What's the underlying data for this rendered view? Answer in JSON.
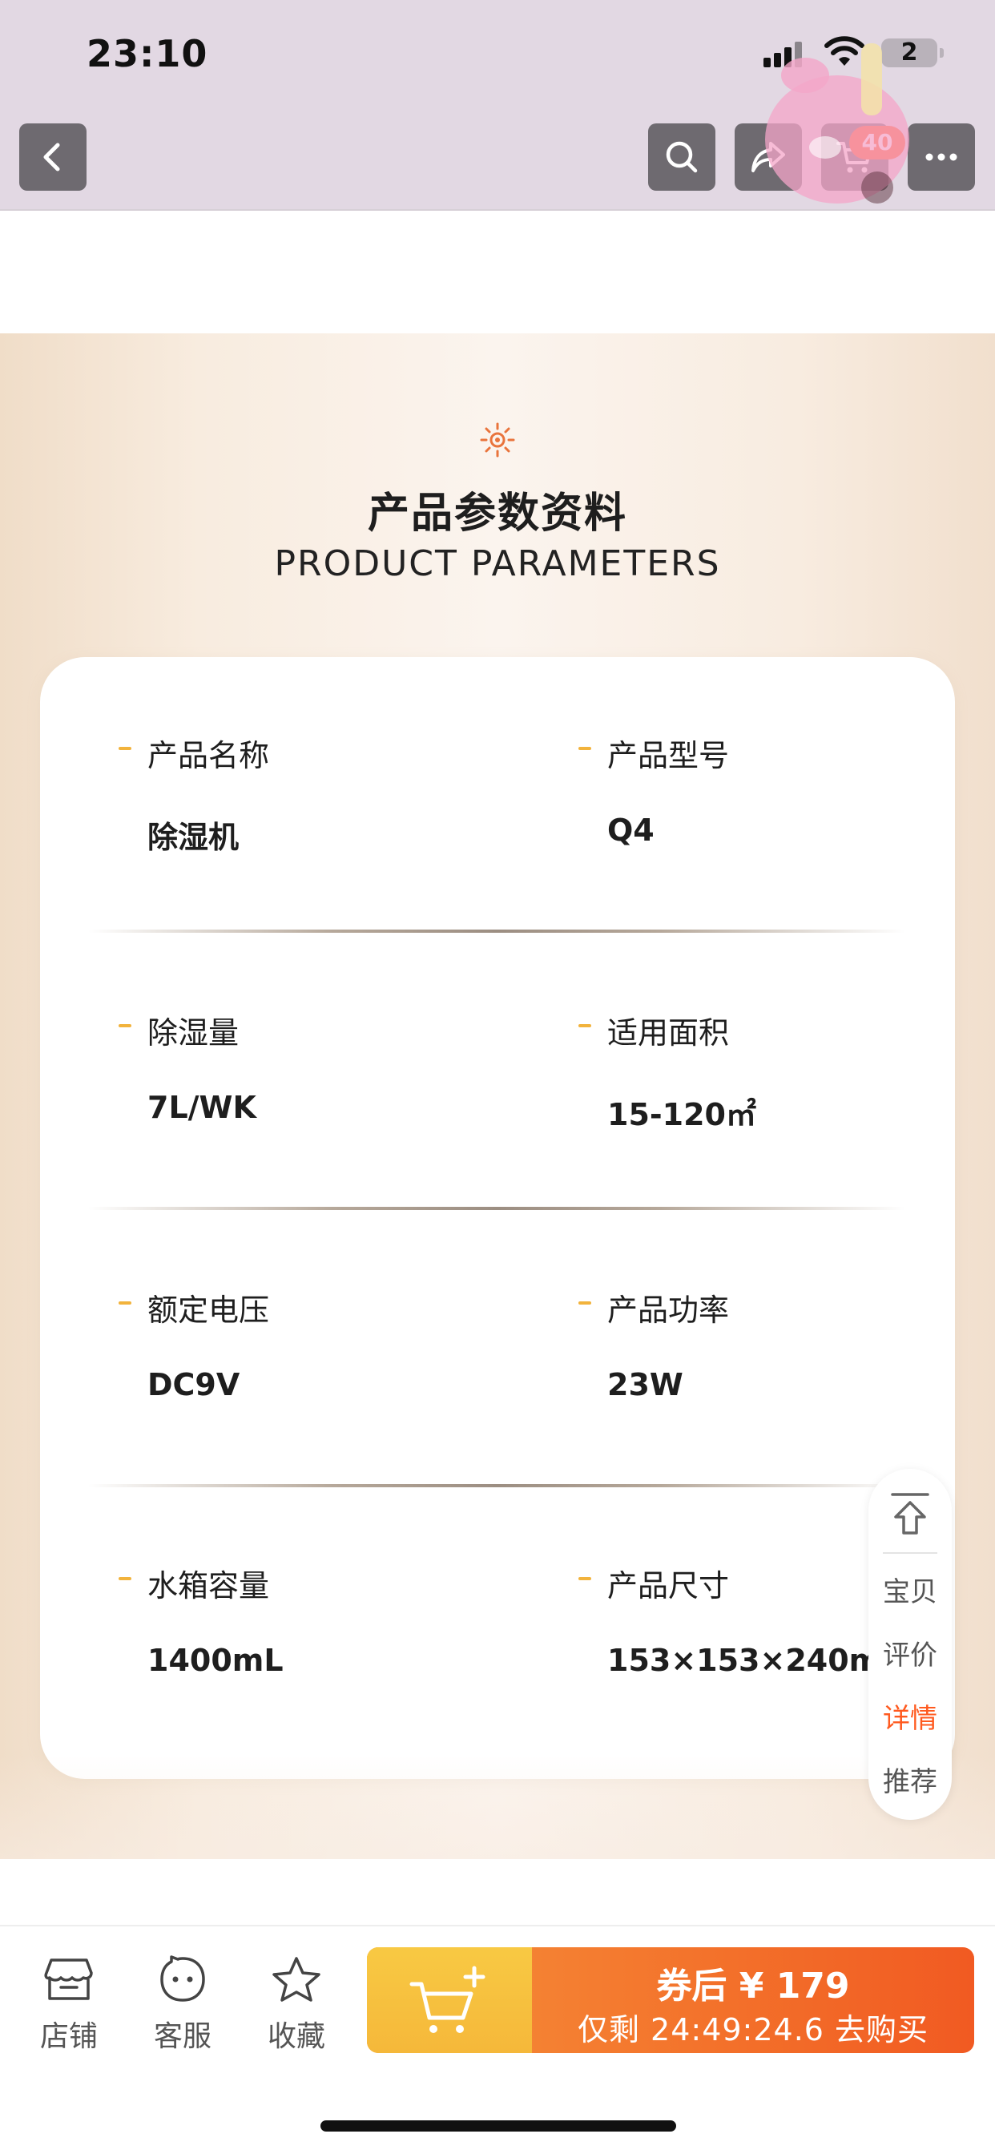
{
  "status_bar": {
    "time": "23:10",
    "battery": "2"
  },
  "header": {
    "cart_badge": "40"
  },
  "params": {
    "title": "产品参数资料",
    "subtitle": "PRODUCT PARAMETERS",
    "rows": [
      [
        {
          "label": "产品名称",
          "value": "除湿机"
        },
        {
          "label": "产品型号",
          "value": "Q4"
        }
      ],
      [
        {
          "label": "除湿量",
          "value": "7L/WK"
        },
        {
          "label": "适用面积",
          "value": "15-120㎡"
        }
      ],
      [
        {
          "label": "额定电压",
          "value": "DC9V"
        },
        {
          "label": "产品功率",
          "value": "23W"
        }
      ],
      [
        {
          "label": "水箱容量",
          "value": "1400mL"
        },
        {
          "label": "产品尺寸",
          "value": "153×153×240mm"
        }
      ]
    ]
  },
  "float_nav": {
    "items": [
      "宝贝",
      "评价",
      "详情",
      "推荐"
    ],
    "active_index": 2
  },
  "bottom_bar": {
    "store": "店铺",
    "service": "客服",
    "favorite": "收藏",
    "buy_price": "券后 ¥ 179",
    "buy_countdown": "仅剩 24:49:24.6 去购买"
  },
  "colors": {
    "accent": "#ff5a1f",
    "buy_gradient_start": "#f5903a",
    "buy_gradient_end": "#f15a22",
    "cart_button": "#f5b83a",
    "label_dash": "#f2b33c"
  },
  "icons": [
    "back-icon",
    "search-icon",
    "share-icon",
    "cart-icon",
    "more-icon",
    "sun-icon",
    "back-to-top-icon",
    "store-icon",
    "service-icon",
    "star-icon",
    "add-to-cart-icon"
  ]
}
